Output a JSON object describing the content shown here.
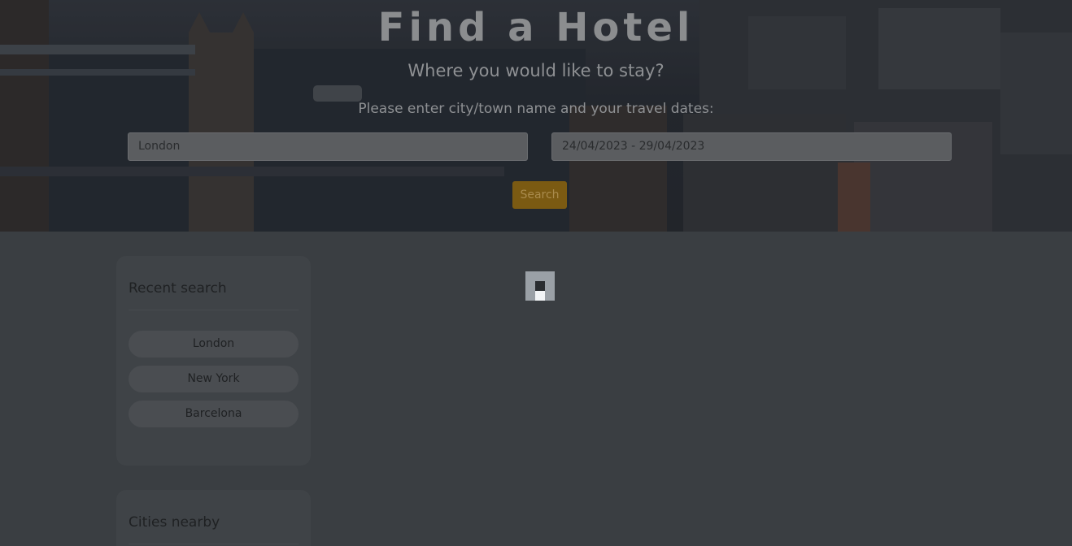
{
  "hero": {
    "title": "Find a Hotel",
    "subtitle": "Where you would like to stay?",
    "instruction": "Please enter city/town name and your travel dates:",
    "city_value": "London",
    "dates_value": "24/04/2023 - 29/04/2023",
    "search_label": "Search"
  },
  "recent": {
    "title": "Recent search",
    "items": [
      "London",
      "New York",
      "Barcelona"
    ]
  },
  "nearby": {
    "title": "Cities nearby"
  },
  "colors": {
    "overlay": "#3a3e42",
    "accent": "#7b5a12"
  },
  "icons": {
    "loader": "loading-spinner-icon"
  }
}
